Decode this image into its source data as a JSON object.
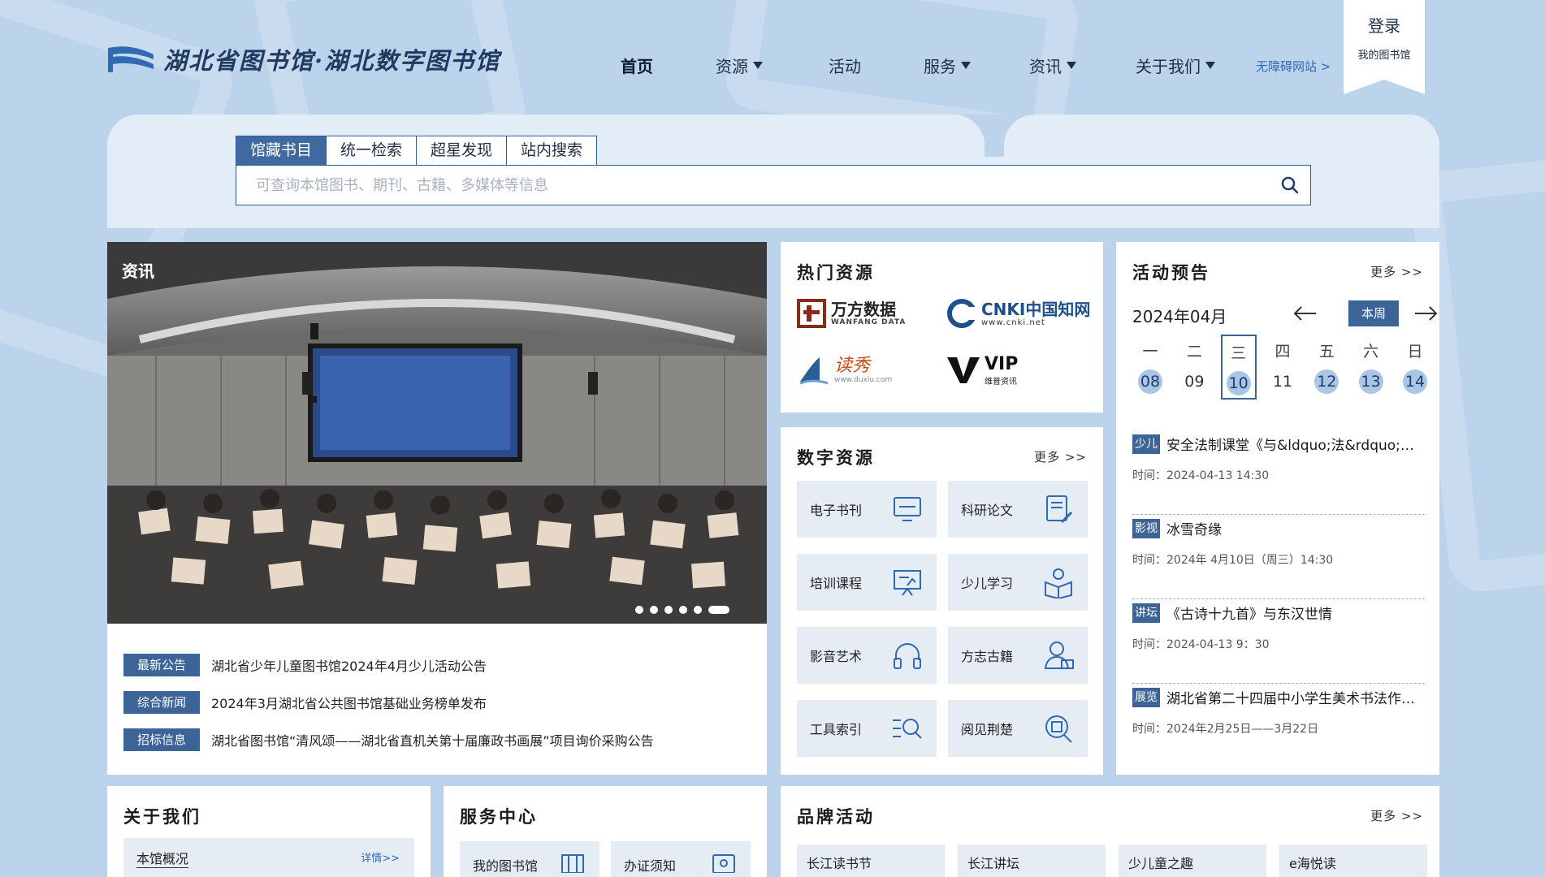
{
  "header": {
    "logo_text": "湖北省图书馆·湖北数字图书馆",
    "nav": [
      {
        "label": "首页",
        "dropdown": false,
        "active": true
      },
      {
        "label": "资源",
        "dropdown": true,
        "active": false
      },
      {
        "label": "活动",
        "dropdown": false,
        "active": false
      },
      {
        "label": "服务",
        "dropdown": true,
        "active": false
      },
      {
        "label": "资讯",
        "dropdown": true,
        "active": false
      },
      {
        "label": "关于我们",
        "dropdown": true,
        "active": false
      }
    ],
    "accessibility_link": "无障碍网站 >",
    "login_label": "登录",
    "my_library_label": "我的图书馆"
  },
  "search": {
    "tabs": [
      "馆藏书目",
      "统一检索",
      "超星发现",
      "站内搜索"
    ],
    "active_tab": 0,
    "placeholder": "可查询本馆图书、期刊、古籍、多媒体等信息",
    "value": ""
  },
  "news": {
    "photo_tag": "资讯",
    "carousel_active": 5,
    "carousel_count": 6,
    "items": [
      {
        "badge": "最新公告",
        "text": "湖北省少年儿童图书馆2024年4月少儿活动公告"
      },
      {
        "badge": "综合新闻",
        "text": "2024年3月湖北省公共图书馆基础业务榜单发布"
      },
      {
        "badge": "招标信息",
        "text": "湖北省图书馆“清风颂——湖北省直机关第十届廉政书画展”项目询价采购公告"
      }
    ]
  },
  "hot_resources": {
    "title": "热门资源",
    "items": [
      {
        "name": "万方数据",
        "sub": "WANFANG DATA",
        "icon": "wanfang-logo"
      },
      {
        "name": "CNKI中国知网",
        "sub": "www.cnki.net",
        "icon": "cnki-logo"
      },
      {
        "name": "读秀",
        "sub": "www.duxiu.com",
        "icon": "duxiu-logo"
      },
      {
        "name": "VIP",
        "sub": "维普资讯",
        "icon": "vip-logo"
      }
    ]
  },
  "digital_resources": {
    "title": "数字资源",
    "more": "更多 >>",
    "items": [
      {
        "label": "电子书刊",
        "icon": "monitor-icon"
      },
      {
        "label": "科研论文",
        "icon": "paper-pen-icon"
      },
      {
        "label": "培训课程",
        "icon": "presentation-icon"
      },
      {
        "label": "少儿学习",
        "icon": "child-book-icon"
      },
      {
        "label": "影音艺术",
        "icon": "headphones-icon"
      },
      {
        "label": "方志古籍",
        "icon": "scholar-icon"
      },
      {
        "label": "工具索引",
        "icon": "list-search-icon"
      },
      {
        "label": "阅见荆楚",
        "icon": "chu-search-icon"
      }
    ]
  },
  "events": {
    "title": "活动预告",
    "more": "更多 >>",
    "month": "2024年04月",
    "this_week_label": "本周",
    "weekdays": [
      "一",
      "二",
      "三",
      "四",
      "五",
      "六",
      "日"
    ],
    "days": [
      {
        "num": "08",
        "has_event": true,
        "today": false
      },
      {
        "num": "09",
        "has_event": false,
        "today": false
      },
      {
        "num": "10",
        "has_event": true,
        "today": true
      },
      {
        "num": "11",
        "has_event": false,
        "today": false
      },
      {
        "num": "12",
        "has_event": true,
        "today": false
      },
      {
        "num": "13",
        "has_event": true,
        "today": false
      },
      {
        "num": "14",
        "has_event": true,
        "today": false
      }
    ],
    "items": [
      {
        "badge": "少儿",
        "title": "安全法制课堂《与&ldquo;法&rdquo;同...",
        "time": "时间：2024-04-13 14:30"
      },
      {
        "badge": "影视",
        "title": "冰雪奇缘",
        "time": "时间：2024年 4月10日（周三）14:30"
      },
      {
        "badge": "讲坛",
        "title": "《古诗十九首》与东汉世情",
        "time": "时间：2024-04-13 9：30"
      },
      {
        "badge": "展览",
        "title": "湖北省第二十四届中小学生美术书法作品展",
        "time": "时间：2024年2月25日——3月22日"
      }
    ]
  },
  "about": {
    "title": "关于我们",
    "row_label": "本馆概况",
    "row_more": "详情>>"
  },
  "service": {
    "title": "服务中心",
    "items": [
      "我的图书馆",
      "办证须知"
    ]
  },
  "brand": {
    "title": "品牌活动",
    "more": "更多 >>",
    "items": [
      "长江读书节",
      "长江讲坛",
      "少儿童之趣",
      "e海悦读"
    ]
  },
  "colors": {
    "background": "#bcd3ec",
    "accent": "#3c6497",
    "panel": "#e3edf7",
    "tile": "#e5ecf4"
  }
}
